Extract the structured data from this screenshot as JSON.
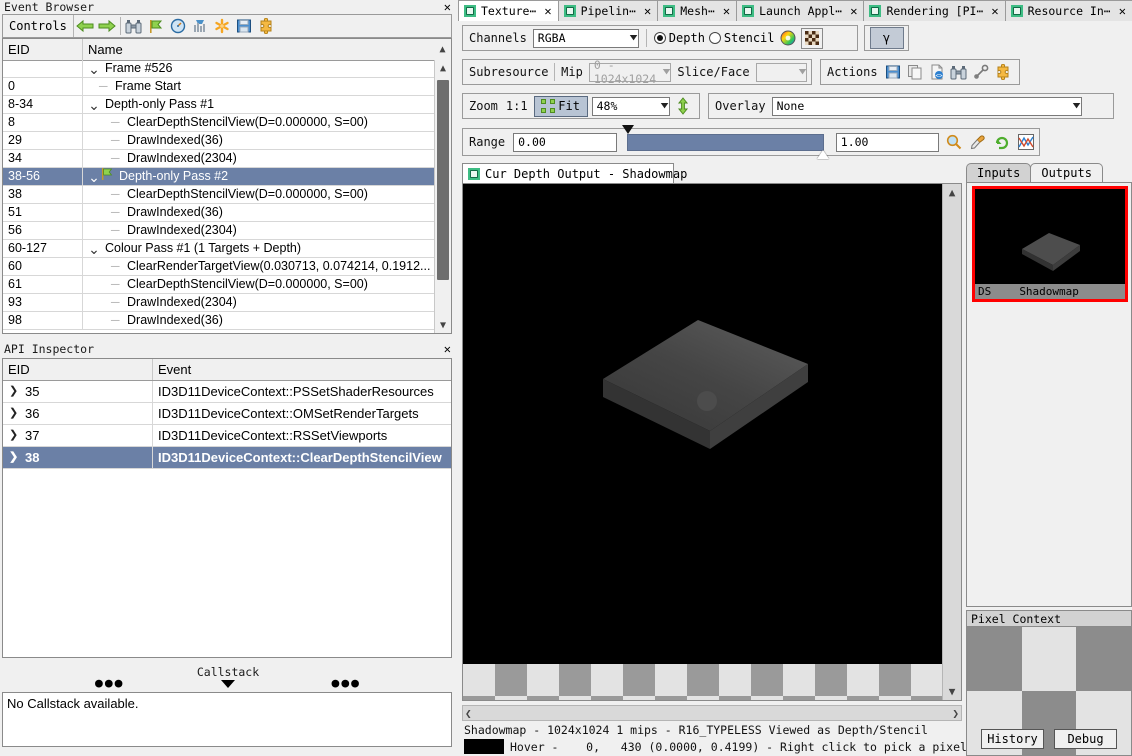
{
  "event_browser": {
    "title": "Event Browser",
    "controls_label": "Controls",
    "toolbar_icons": [
      "back-arrow-icon",
      "forward-arrow-icon",
      "binoculars-icon",
      "green-flag-icon",
      "timer-icon",
      "bar-chart-icon",
      "asterisk-icon",
      "floppy-disk-icon",
      "puzzle-piece-icon"
    ],
    "columns": [
      "EID",
      "Name"
    ],
    "rows": [
      {
        "eid": "",
        "name": "Frame #526",
        "indent": 0,
        "chevron": "v",
        "flag": false,
        "selected": false
      },
      {
        "eid": "0",
        "name": "Frame Start",
        "indent": 1,
        "chevron": "",
        "flag": false,
        "selected": false
      },
      {
        "eid": "8-34",
        "name": "Depth-only Pass #1",
        "indent": 0,
        "chevron": "v",
        "flag": false,
        "selected": false
      },
      {
        "eid": "8",
        "name": "ClearDepthStencilView(D=0.000000, S=00)",
        "indent": 2,
        "chevron": "",
        "flag": false,
        "selected": false
      },
      {
        "eid": "29",
        "name": "DrawIndexed(36)",
        "indent": 2,
        "chevron": "",
        "flag": false,
        "selected": false
      },
      {
        "eid": "34",
        "name": "DrawIndexed(2304)",
        "indent": 2,
        "chevron": "",
        "flag": false,
        "selected": false
      },
      {
        "eid": "38-56",
        "name": "Depth-only Pass #2",
        "indent": 0,
        "chevron": "v",
        "flag": true,
        "selected": true
      },
      {
        "eid": "38",
        "name": "ClearDepthStencilView(D=0.000000, S=00)",
        "indent": 2,
        "chevron": "",
        "flag": false,
        "selected": false
      },
      {
        "eid": "51",
        "name": "DrawIndexed(36)",
        "indent": 2,
        "chevron": "",
        "flag": false,
        "selected": false
      },
      {
        "eid": "56",
        "name": "DrawIndexed(2304)",
        "indent": 2,
        "chevron": "",
        "flag": false,
        "selected": false
      },
      {
        "eid": "60-127",
        "name": "Colour Pass #1 (1 Targets + Depth)",
        "indent": 0,
        "chevron": "v",
        "flag": false,
        "selected": false
      },
      {
        "eid": "60",
        "name": "ClearRenderTargetView(0.030713, 0.074214, 0.1912...",
        "indent": 2,
        "chevron": "",
        "flag": false,
        "selected": false
      },
      {
        "eid": "61",
        "name": "ClearDepthStencilView(D=0.000000, S=00)",
        "indent": 2,
        "chevron": "",
        "flag": false,
        "selected": false
      },
      {
        "eid": "93",
        "name": "DrawIndexed(2304)",
        "indent": 2,
        "chevron": "",
        "flag": false,
        "selected": false
      },
      {
        "eid": "98",
        "name": "DrawIndexed(36)",
        "indent": 2,
        "chevron": "",
        "flag": false,
        "selected": false
      }
    ]
  },
  "api_inspector": {
    "title": "API Inspector",
    "columns": [
      "EID",
      "Event"
    ],
    "rows": [
      {
        "eid": "35",
        "event": "ID3D11DeviceContext::PSSetShaderResources",
        "selected": false
      },
      {
        "eid": "36",
        "event": "ID3D11DeviceContext::OMSetRenderTargets",
        "selected": false
      },
      {
        "eid": "37",
        "event": "ID3D11DeviceContext::RSSetViewports",
        "selected": false
      },
      {
        "eid": "38",
        "event": "ID3D11DeviceContext::ClearDepthStencilView",
        "selected": true
      }
    ]
  },
  "callstack": {
    "title": "Callstack",
    "message": "No Callstack available."
  },
  "tabs": [
    {
      "label": "Texture⋯",
      "active": true
    },
    {
      "label": "Pipelin⋯",
      "active": false
    },
    {
      "label": "Mesh⋯",
      "active": false
    },
    {
      "label": "Launch Appl⋯",
      "active": false
    },
    {
      "label": "Rendering [PI⋯",
      "active": false
    },
    {
      "label": "Resource In⋯",
      "active": false
    }
  ],
  "channels_bar": {
    "label": "Channels",
    "value": "RGBA",
    "depth_label": "Depth",
    "stencil_label": "Stencil",
    "depth_selected": true,
    "gamma_label": "γ",
    "icons": [
      "color-wheel-icon",
      "checkerboard-icon"
    ]
  },
  "subresource_bar": {
    "label": "Subresource",
    "mip_label": "Mip",
    "mip_value": "0 - 1024x1024",
    "slice_label": "Slice/Face",
    "slice_value": "",
    "actions_label": "Actions",
    "action_icons": [
      "save-icon",
      "copy-icon",
      "open-file-icon",
      "binoculars-icon",
      "pin-icon",
      "puzzle-piece-icon"
    ]
  },
  "zoom_bar": {
    "zoom_label": "Zoom",
    "one_to_one_label": "1:1",
    "fit_label": "Fit",
    "zoom_value": "48%",
    "flip_icon": "flip-vertical-icon",
    "overlay_label": "Overlay",
    "overlay_value": "None"
  },
  "range_bar": {
    "label": "Range",
    "min_value": "0.00",
    "max_value": "1.00",
    "icons": [
      "magnifier-icon",
      "eyedropper-icon",
      "reset-icon",
      "histogram-icon"
    ]
  },
  "viewer_tab": {
    "label": "Cur Depth Output - Shadowmap"
  },
  "status": {
    "line1": "Shadowmap - 1024x1024 1 mips - R16_TYPELESS Viewed as Depth/Stencil",
    "line2": "Hover -    0,   430 (0.0000, 0.4199) - Right click to pick a pixel"
  },
  "io_panel": {
    "tabs": [
      {
        "label": "Inputs",
        "active": false
      },
      {
        "label": "Outputs",
        "active": true
      }
    ],
    "thumbnail": {
      "slot": "DS",
      "name": "Shadowmap",
      "highlight_color": "#ff0000"
    }
  },
  "pixel_context": {
    "title": "Pixel Context",
    "history_label": "History",
    "debug_label": "Debug",
    "cells": [
      "#8c8c8c",
      "#e3e3e3",
      "#8c8c8c",
      "#e3e3e3",
      "#8c8c8c",
      "#e3e3e3"
    ]
  },
  "colors": {
    "selection": "#6b80a6",
    "chrome": "#f0f0f0",
    "tab_accent": "#3ebd84",
    "highlight": "#ff0000",
    "range_fill": "#6b80a6"
  }
}
